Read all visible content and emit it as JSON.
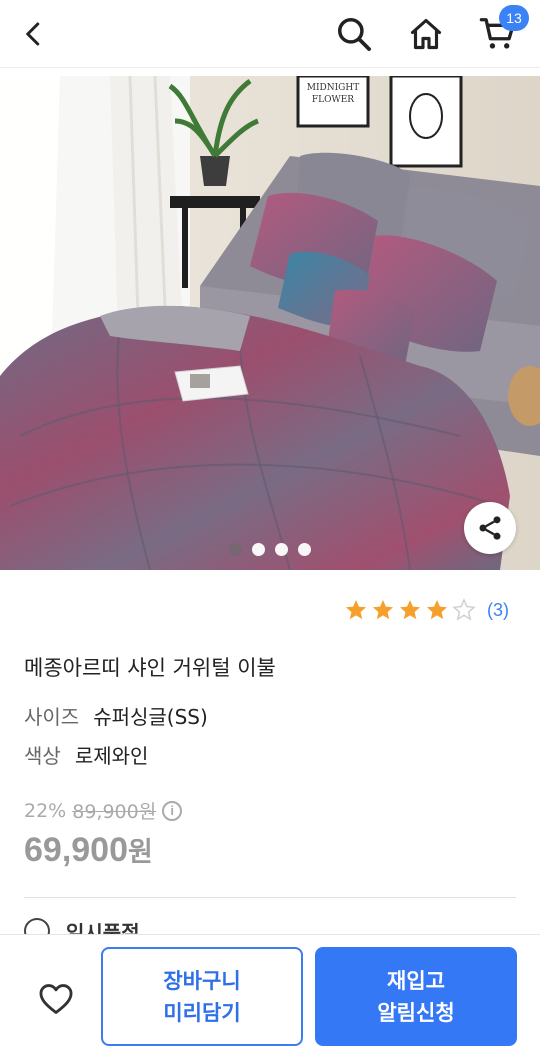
{
  "header": {
    "cart_count": "13"
  },
  "gallery": {
    "photo_text_frame1": "MIDNIGHT",
    "photo_text_frame2": "FLOWER",
    "current_slide": 1,
    "slide_count": 4
  },
  "rating": {
    "stars": 4,
    "max_stars": 5,
    "count": "(3)"
  },
  "product": {
    "title": "메종아르띠 샤인 거위털 이불",
    "size_label": "사이즈",
    "size_value": "슈퍼싱글(SS)",
    "color_label": "색상",
    "color_value": "로제와인",
    "discount": "22%",
    "original_price": "89,900원",
    "price_number": "69,900",
    "price_unit": "원",
    "next_section": "일시품절"
  },
  "actions": {
    "cart_line1": "장바구니",
    "cart_line2": "미리담기",
    "notify_line1": "재입고",
    "notify_line2": "알림신청"
  },
  "colors": {
    "accent": "#3478f6",
    "star": "#f5a02c"
  }
}
